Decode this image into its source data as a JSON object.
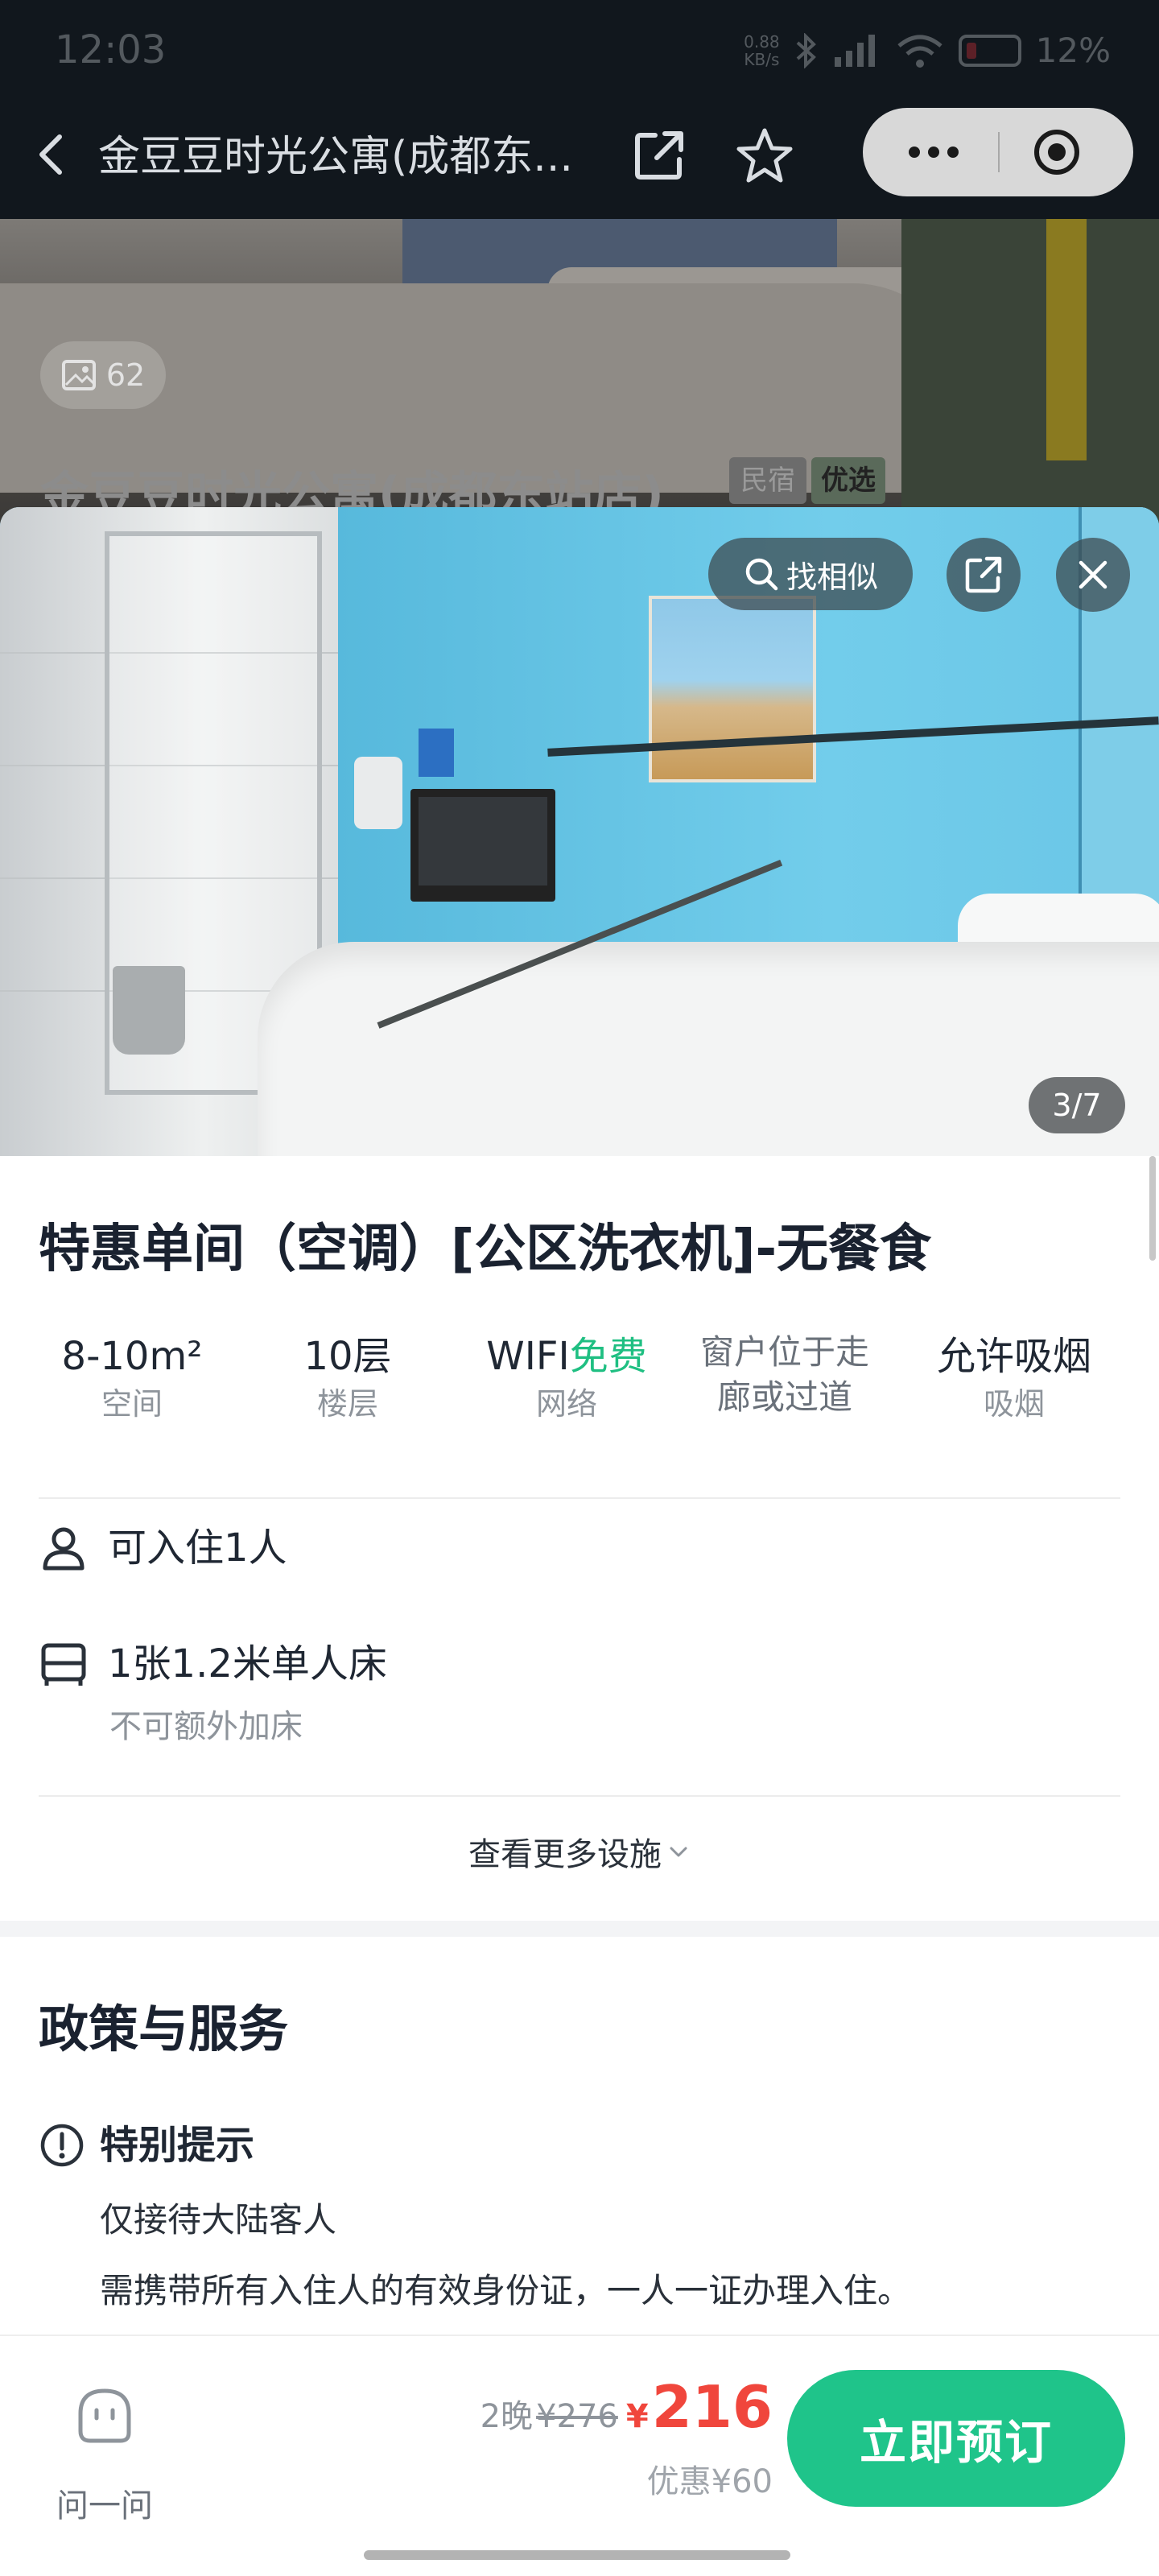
{
  "status_bar": {
    "time": "12:03",
    "network_speed": "0.88\nKB/s",
    "battery": "12%"
  },
  "header": {
    "title": "金豆豆时光公寓(成都东...",
    "back_icon": "chevron-left-icon",
    "share_icon": "share-external-icon",
    "favorite_icon": "star-outline-icon",
    "more_icon": "more-dots-icon",
    "target_icon": "record-target-icon"
  },
  "background_listing": {
    "photo_count": "62",
    "hotel_name": "金豆豆时光公寓(成都东站店)",
    "tag_type": "民宿",
    "tag_badge": "优选"
  },
  "photo_viewer": {
    "find_similar_label": "找相似",
    "index_text": "3/7",
    "search_icon": "search-icon",
    "share_icon": "share-external-icon",
    "close_icon": "close-icon"
  },
  "room": {
    "name": "特惠单间（空调）[公区洗衣机]-无餐食",
    "specs": [
      {
        "value": "8-10m²",
        "label": "空间"
      },
      {
        "value": "10层",
        "label": "楼层"
      },
      {
        "value_prefix": "WIFI",
        "value_highlight": "免费",
        "label": "网络"
      },
      {
        "note": "窗户位于走廊或过道"
      },
      {
        "value": "允许吸烟",
        "label": "吸烟"
      }
    ],
    "occupancy": "可入住1人",
    "bed": "1张1.2米单人床",
    "bed_note": "不可额外加床",
    "more_facilities": "查看更多设施",
    "accent_color": "#1fbf82"
  },
  "policy": {
    "title": "政策与服务",
    "notice_title": "特别提示",
    "lines": [
      "仅接待大陆客人",
      "需携带所有入住人的有效身份证，一人一证办理入住。"
    ]
  },
  "bottom_bar": {
    "ask_label": "问一问",
    "nights": "2晚",
    "original_price": "¥276",
    "currency": "¥",
    "final_price": "216",
    "discount": "优惠¥60",
    "book_label": "立即预订",
    "book_color": "#1fc48a",
    "price_color": "#f0463c"
  }
}
